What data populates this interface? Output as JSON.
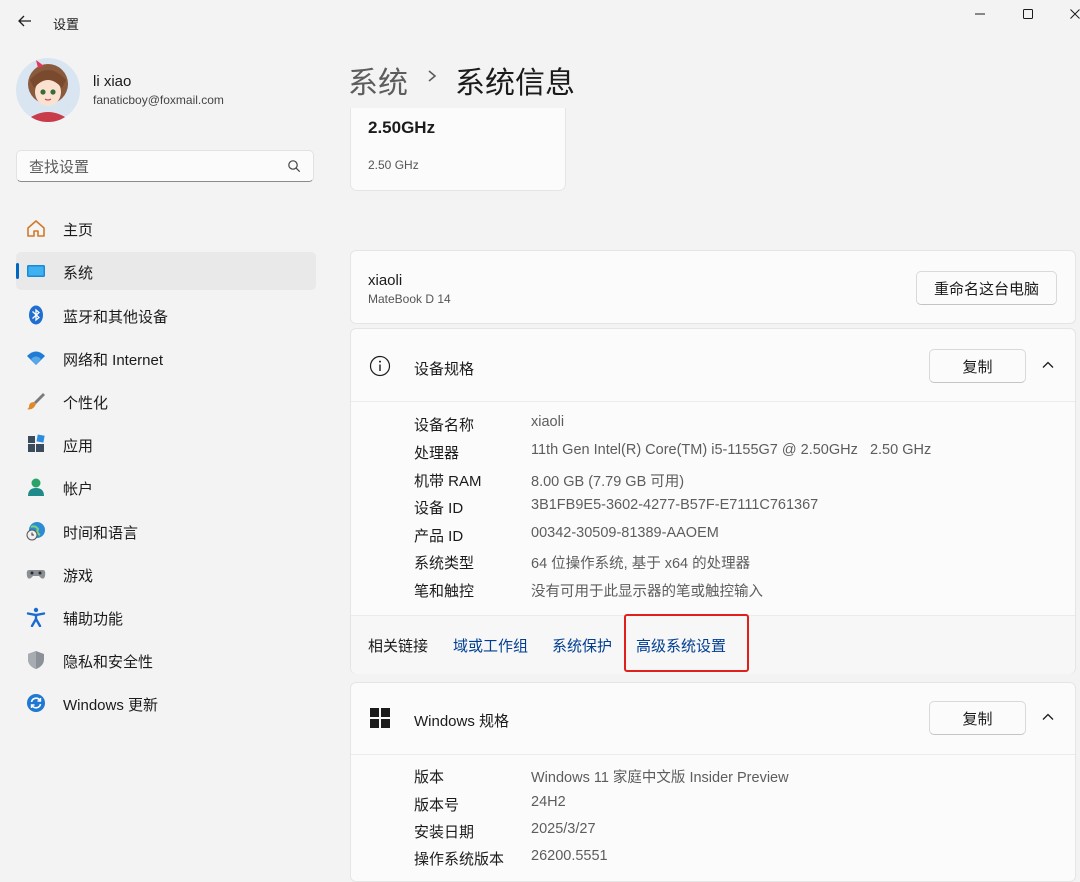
{
  "window": {
    "title": "设置",
    "back_icon": "arrow-left-icon",
    "controls": [
      "minimize-icon",
      "maximize-icon",
      "close-icon"
    ]
  },
  "user": {
    "name": "li xiao",
    "email": "fanaticboy@foxmail.com"
  },
  "search": {
    "placeholder": "查找设置",
    "icon": "search-icon"
  },
  "sidebar": {
    "items": [
      {
        "label": "主页",
        "icon": "home-icon"
      },
      {
        "label": "系统",
        "icon": "system-display-icon",
        "active": true
      },
      {
        "label": "蓝牙和其他设备",
        "icon": "bluetooth-icon"
      },
      {
        "label": "网络和 Internet",
        "icon": "wifi-icon"
      },
      {
        "label": "个性化",
        "icon": "paintbrush-icon"
      },
      {
        "label": "应用",
        "icon": "apps-icon"
      },
      {
        "label": "帐户",
        "icon": "account-icon"
      },
      {
        "label": "时间和语言",
        "icon": "globe-clock-icon"
      },
      {
        "label": "游戏",
        "icon": "gamepad-icon"
      },
      {
        "label": "辅助功能",
        "icon": "accessibility-icon"
      },
      {
        "label": "隐私和安全性",
        "icon": "shield-icon"
      },
      {
        "label": "Windows 更新",
        "icon": "update-icon"
      }
    ]
  },
  "header": {
    "parent": "系统",
    "current": "系统信息"
  },
  "cpu_card": {
    "speed_title": "2.50GHz",
    "speed_sub": "2.50 GHz"
  },
  "pc": {
    "name": "xiaoli",
    "model": "MateBook D 14",
    "rename_label": "重命名这台电脑"
  },
  "device_specs": {
    "title": "设备规格",
    "icon": "info-icon",
    "copy_label": "复制",
    "rows": [
      {
        "key": "设备名称",
        "value": "xiaoli"
      },
      {
        "key": "处理器",
        "value": "11th Gen Intel(R) Core(TM) i5-1155G7 @ 2.50GHz   2.50 GHz"
      },
      {
        "key": "机带 RAM",
        "value": "8.00 GB (7.79 GB 可用)"
      },
      {
        "key": "设备 ID",
        "value": "3B1FB9E5-3602-4277-B57F-E7111C761367"
      },
      {
        "key": "产品 ID",
        "value": "00342-30509-81389-AAOEM"
      },
      {
        "key": "系统类型",
        "value": "64 位操作系统, 基于 x64 的处理器"
      },
      {
        "key": "笔和触控",
        "value": "没有可用于此显示器的笔或触控输入"
      }
    ]
  },
  "related": {
    "label": "相关链接",
    "links": [
      "域或工作组",
      "系统保护",
      "高级系统设置"
    ],
    "highlight_color": "#e0201b"
  },
  "windows_specs": {
    "title": "Windows 规格",
    "icon": "windows-logo-icon",
    "copy_label": "复制",
    "rows": [
      {
        "key": "版本",
        "value": "Windows 11 家庭中文版 Insider Preview"
      },
      {
        "key": "版本号",
        "value": "24H2"
      },
      {
        "key": "安装日期",
        "value": "2025/3/27"
      },
      {
        "key": "操作系统版本",
        "value": "26200.5551"
      }
    ]
  },
  "colors": {
    "accent": "#0067c0",
    "link": "#003e92",
    "background": "#f3f3f3",
    "card": "#fbfbfb"
  }
}
